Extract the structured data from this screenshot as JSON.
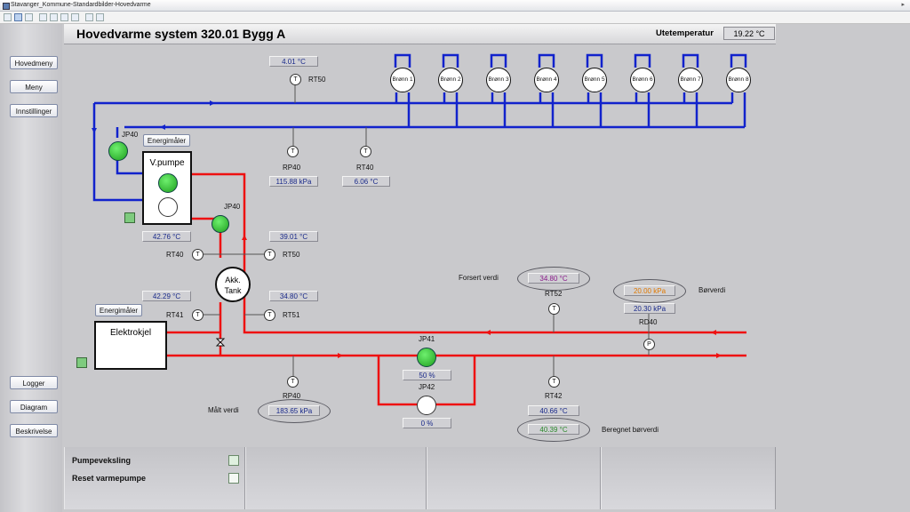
{
  "window": {
    "title": "Stavanger_Kommune-Standardbilder-Hovedvarme"
  },
  "nav": {
    "main_menu": "Hovedmeny",
    "menu": "Meny",
    "settings": "Innstillinger",
    "logs": "Logger",
    "diagram": "Diagram",
    "description": "Beskrivelse"
  },
  "header": {
    "title": "Hovedvarme system 320.01 Bygg A",
    "outdoor_label": "Utetemperatur",
    "outdoor_value": "19.22 °C"
  },
  "wells": [
    "Brønn 1",
    "Brønn 2",
    "Brønn 3",
    "Brønn 4",
    "Brønn 5",
    "Brønn 6",
    "Brønn 7",
    "Brønn 8"
  ],
  "colors": {
    "supply": "#ee1111",
    "return": "#1122cc",
    "pump_on": "#22aa22"
  },
  "diagram": {
    "rt50_top": {
      "label": "RT50",
      "value": "4.01 °C",
      "symbol": "T"
    },
    "rp40_top": {
      "label": "RP40",
      "value": "115.88 kPa",
      "symbol": "T"
    },
    "rt40_top": {
      "label": "RT40",
      "value": "6.06 °C",
      "symbol": "T"
    },
    "jp40_cold": {
      "label": "JP40"
    },
    "jp40_hot": {
      "label": "JP40"
    },
    "energy_meter_1": "Energimåler",
    "energy_meter_2": "Energimåler",
    "heat_pump": {
      "label": "V.pumpe",
      "value": "42.76 °C"
    },
    "rt40_mid": {
      "label": "RT40",
      "symbol": "T"
    },
    "rt50_mid": {
      "label": "RT50",
      "value": "39.01 °C",
      "symbol": "T"
    },
    "tank": {
      "line1": "Akk.",
      "line2": "Tank"
    },
    "rt41": {
      "label": "RT41",
      "value": "42.29 °C",
      "symbol": "T"
    },
    "rt51": {
      "label": "RT51",
      "value": "34.80 °C",
      "symbol": "T"
    },
    "boiler": {
      "label": "Elektrokjel"
    },
    "forced": {
      "label": "Forsert verdi",
      "value": "34.80 °C"
    },
    "rt52": {
      "label": "RT52",
      "symbol": "T"
    },
    "setpoint": {
      "label": "Børverdi",
      "value": "20.00 kPa"
    },
    "rd40": {
      "label": "RD40",
      "value": "20.30 kPa",
      "symbol": "P"
    },
    "jp41": {
      "label": "JP41",
      "value": "50 %"
    },
    "jp42": {
      "label": "JP42",
      "value": "0 %"
    },
    "rp40_bot": {
      "label": "RP40",
      "value": "183.65 kPa",
      "symbol": "T",
      "measured_label": "Målt verdi"
    },
    "rt42": {
      "label": "RT42",
      "value": "40.66 °C",
      "symbol": "T"
    },
    "calc": {
      "label": "Beregnet børverdi",
      "value": "40.39 °C"
    }
  },
  "bottom": {
    "pump_switch": "Pumpeveksling",
    "reset_pump": "Reset varmepumpe"
  }
}
